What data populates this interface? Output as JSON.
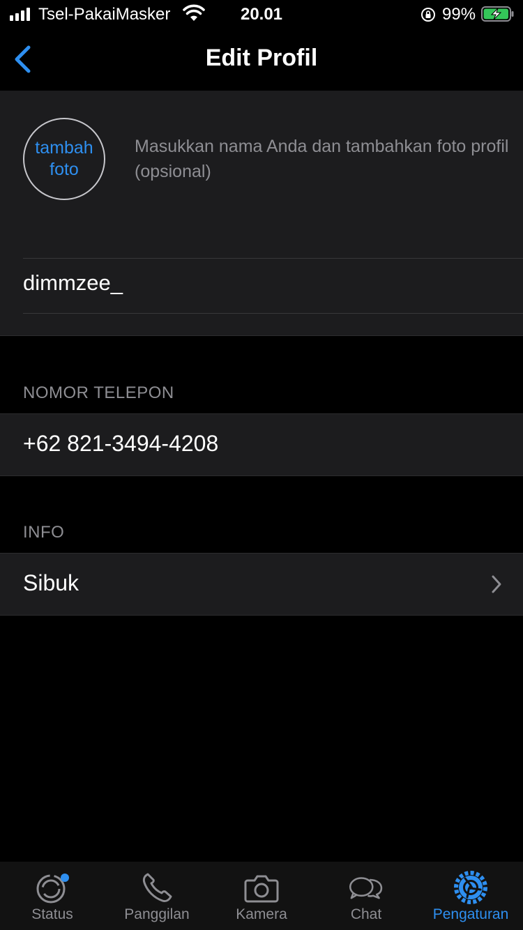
{
  "status_bar": {
    "carrier": "Tsel-PakaiMasker",
    "time": "20.01",
    "battery_percent": "99%",
    "battery_level": 0.99
  },
  "header": {
    "back_icon": "chevron-left-icon",
    "title": "Edit Profil"
  },
  "profile": {
    "add_photo_line1": "tambah",
    "add_photo_line2": "foto",
    "hint": "Masukkan nama Anda dan tambahkan foto profil (opsional)",
    "name_value": "dimmzee_"
  },
  "phone_section": {
    "header": "NOMOR TELEPON",
    "value": "+62 821-3494-4208"
  },
  "info_section": {
    "header": "INFO",
    "value": "Sibuk"
  },
  "tabbar": {
    "tabs": [
      {
        "label": "Status",
        "icon": "status-icon"
      },
      {
        "label": "Panggilan",
        "icon": "phone-icon"
      },
      {
        "label": "Kamera",
        "icon": "camera-icon"
      },
      {
        "label": "Chat",
        "icon": "chat-bubbles-icon"
      },
      {
        "label": "Pengaturan",
        "icon": "settings-gear-icon",
        "active": true
      }
    ]
  },
  "colors": {
    "accent": "#2e8ff0",
    "background": "#000000",
    "cell": "#1c1c1e",
    "secondary_text": "#8e8e93",
    "battery": "#34c759"
  }
}
